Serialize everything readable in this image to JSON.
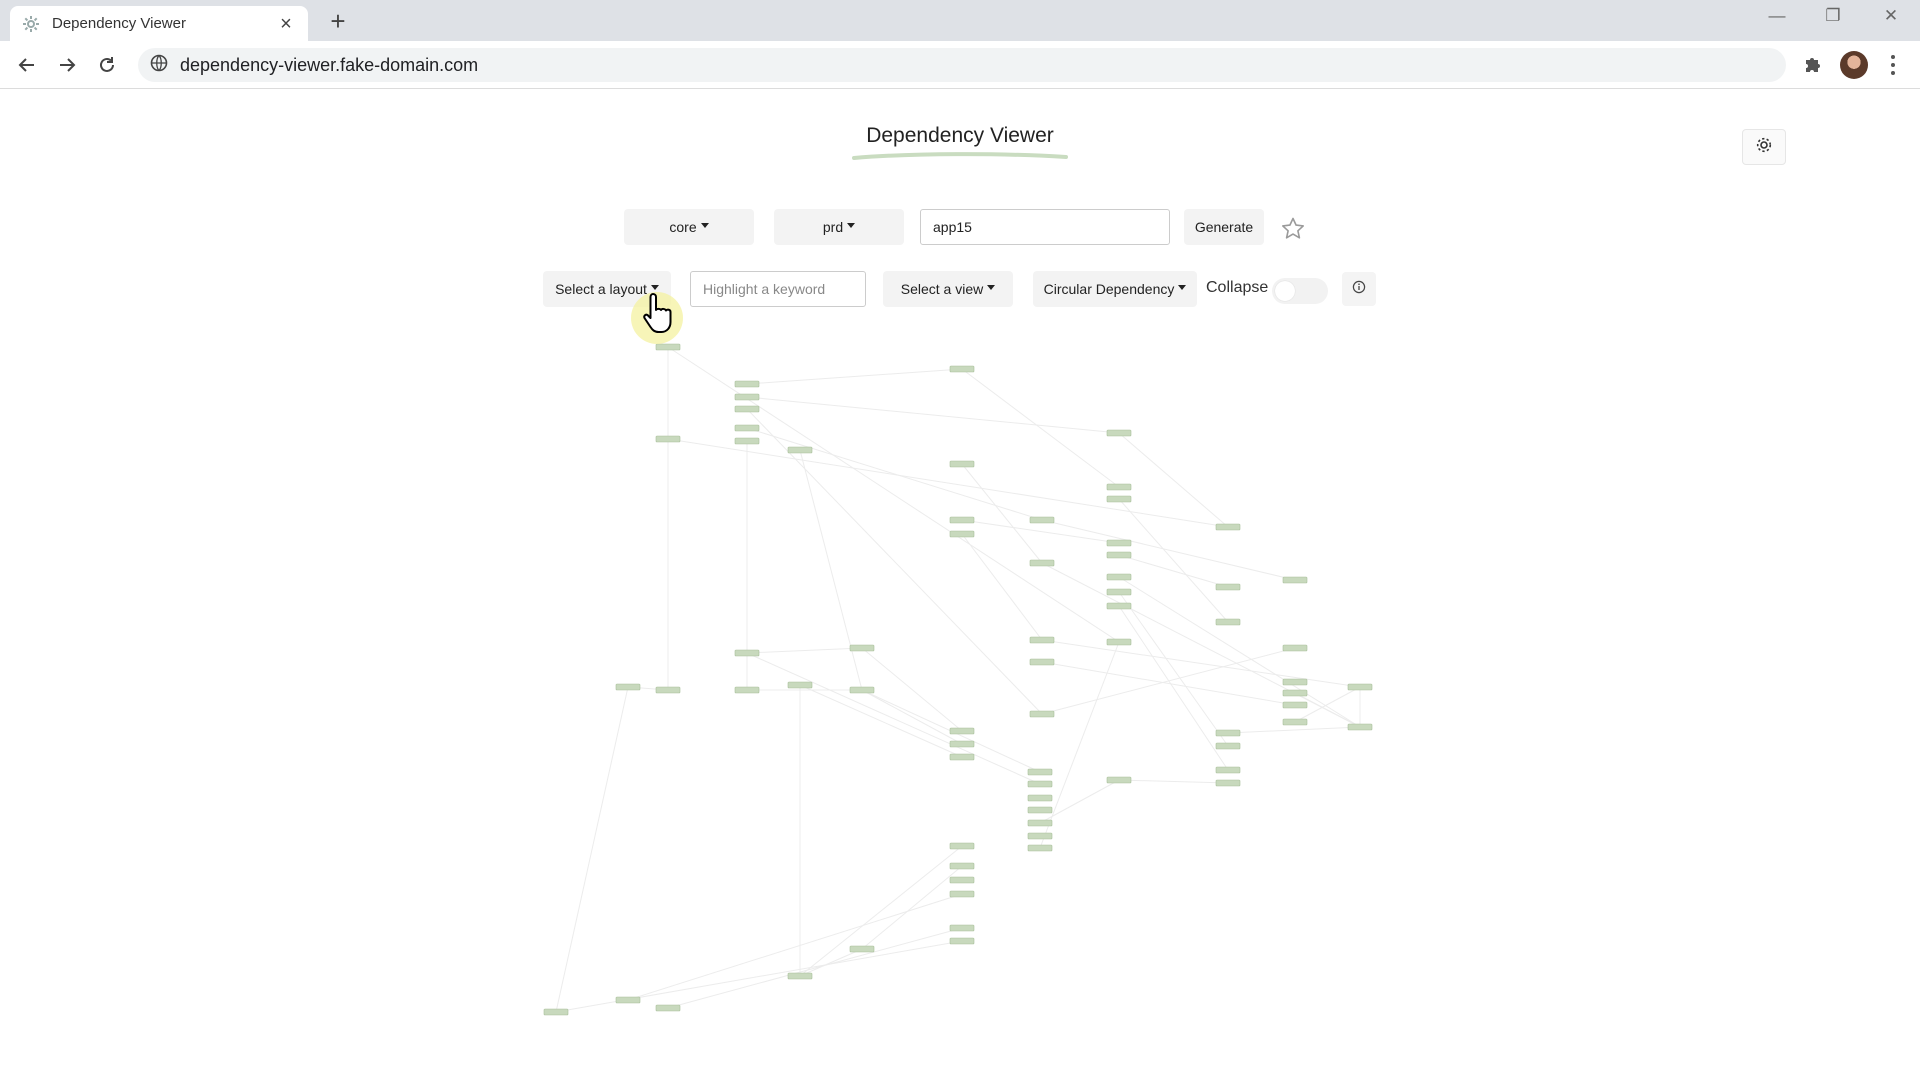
{
  "browser": {
    "tab_title": "Dependency Viewer",
    "url": "dependency-viewer.fake-domain.com"
  },
  "page": {
    "title": "Dependency Viewer"
  },
  "controls": {
    "namespace_dropdown": "core",
    "environment_dropdown": "prd",
    "app_input_value": "app15",
    "generate_label": "Generate",
    "layout_dropdown": "Select a layout",
    "highlight_placeholder": "Highlight a keyword",
    "view_dropdown": "Select a view",
    "circular_dependency_dropdown": "Circular Dependency",
    "collapse_label": "Collapse",
    "collapse_enabled": false
  },
  "colors": {
    "node_fill": "#c8d9bd",
    "node_stroke": "#a9bf9b",
    "edge": "#ececec",
    "title_underline": "#c9dcc0",
    "cursor_highlight": "#f4f1a0"
  },
  "icons": [
    "settings-favicon",
    "close-icon",
    "plus-icon",
    "back-icon",
    "forward-icon",
    "reload-icon",
    "site-info-icon",
    "extensions-icon",
    "avatar",
    "menu-icon",
    "gear-icon",
    "star-icon",
    "info-icon",
    "hand-cursor"
  ]
}
